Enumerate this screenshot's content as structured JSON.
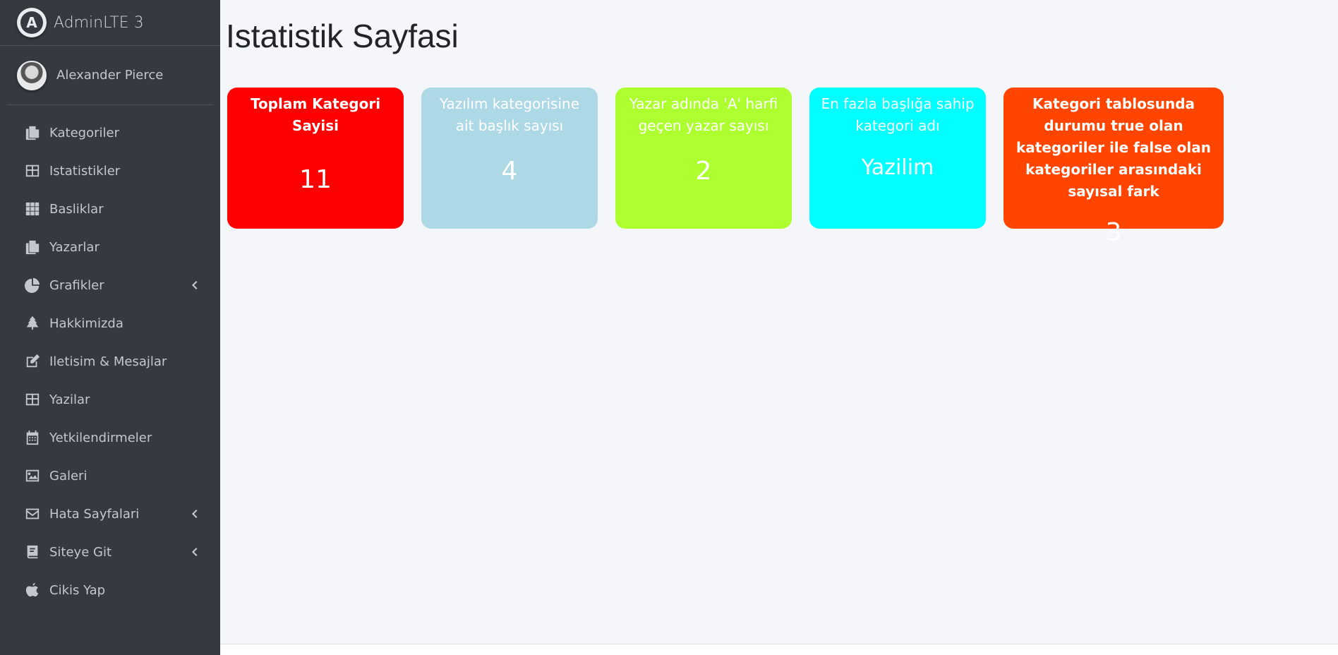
{
  "brand": {
    "name": "AdminLTE 3",
    "logo_letter": "A"
  },
  "user": {
    "name": "Alexander Pierce"
  },
  "nav": [
    {
      "label": "Kategoriler",
      "icon": "copy-icon",
      "has_arrow": false
    },
    {
      "label": "Istatistikler",
      "icon": "table-icon",
      "has_arrow": false
    },
    {
      "label": "Basliklar",
      "icon": "th-icon",
      "has_arrow": false
    },
    {
      "label": "Yazarlar",
      "icon": "copy-icon",
      "has_arrow": false
    },
    {
      "label": "Grafikler",
      "icon": "chart-pie-icon",
      "has_arrow": true
    },
    {
      "label": "Hakkimizda",
      "icon": "tree-icon",
      "has_arrow": false
    },
    {
      "label": "Iletisim & Mesajlar",
      "icon": "edit-icon",
      "has_arrow": false
    },
    {
      "label": "Yazilar",
      "icon": "table-icon",
      "has_arrow": false
    },
    {
      "label": "Yetkilendirmeler",
      "icon": "calendar-icon",
      "has_arrow": false
    },
    {
      "label": "Galeri",
      "icon": "image-icon",
      "has_arrow": false
    },
    {
      "label": "Hata Sayfalari",
      "icon": "envelope-icon",
      "has_arrow": true
    },
    {
      "label": "Siteye Git",
      "icon": "book-icon",
      "has_arrow": true
    },
    {
      "label": "Cikis Yap",
      "icon": "apple-icon",
      "has_arrow": false
    }
  ],
  "page": {
    "title": "Istatistik Sayfasi"
  },
  "cards": [
    {
      "title": "Toplam Kategori Sayisi",
      "value": "11",
      "color": "#ff0000"
    },
    {
      "title": "Yazılım kategorisine ait başlık sayısı",
      "value": "4",
      "color": "#add8e6"
    },
    {
      "title": "Yazar adında 'A' harfi geçen yazar sayısı",
      "value": "2",
      "color": "#adff2f"
    },
    {
      "title": "En fazla başlığa sahip kategori adı",
      "value": "Yazilim",
      "color": "#00ffff"
    },
    {
      "title": "Kategori tablosunda durumu true olan kategoriler ile false olan kategoriler arasındaki sayısal fark",
      "value": "3",
      "color": "#ff4500"
    }
  ],
  "colors": {
    "sidebar_bg": "#343a40",
    "content_bg": "#f4f6f9"
  }
}
